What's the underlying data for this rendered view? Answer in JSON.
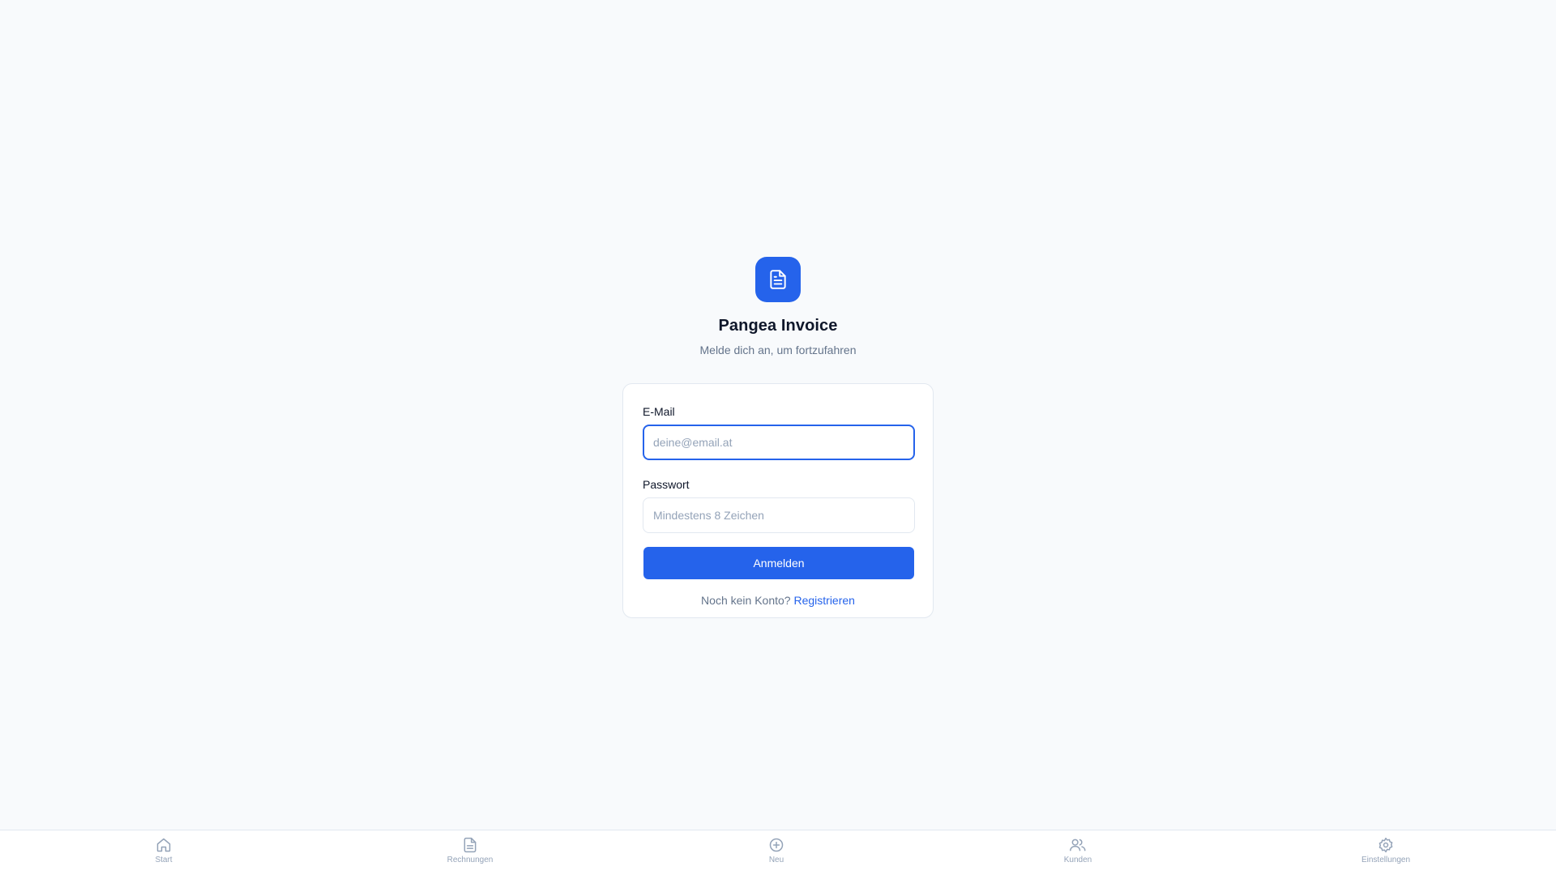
{
  "brand": {
    "title": "Pangea Invoice",
    "subtitle": "Melde dich an, um fortzufahren",
    "icon": "document-icon"
  },
  "login": {
    "email_label": "E-Mail",
    "email_placeholder": "deine@email.at",
    "email_value": "",
    "password_label": "Passwort",
    "password_placeholder": "Mindestens 8 Zeichen",
    "password_value": "",
    "submit_label": "Anmelden",
    "register_prompt": "Noch kein Konto?",
    "register_link": "Registrieren"
  },
  "nav": {
    "items": [
      {
        "label": "Start",
        "icon": "home-icon"
      },
      {
        "label": "Rechnungen",
        "icon": "document-icon"
      },
      {
        "label": "Neu",
        "icon": "plus-circle-icon"
      },
      {
        "label": "Kunden",
        "icon": "users-icon"
      },
      {
        "label": "Einstellungen",
        "icon": "gear-icon"
      }
    ]
  },
  "colors": {
    "accent": "#2563eb",
    "background": "#f8fafc",
    "muted_text": "#64748b",
    "nav_icon": "#94a3b8"
  }
}
